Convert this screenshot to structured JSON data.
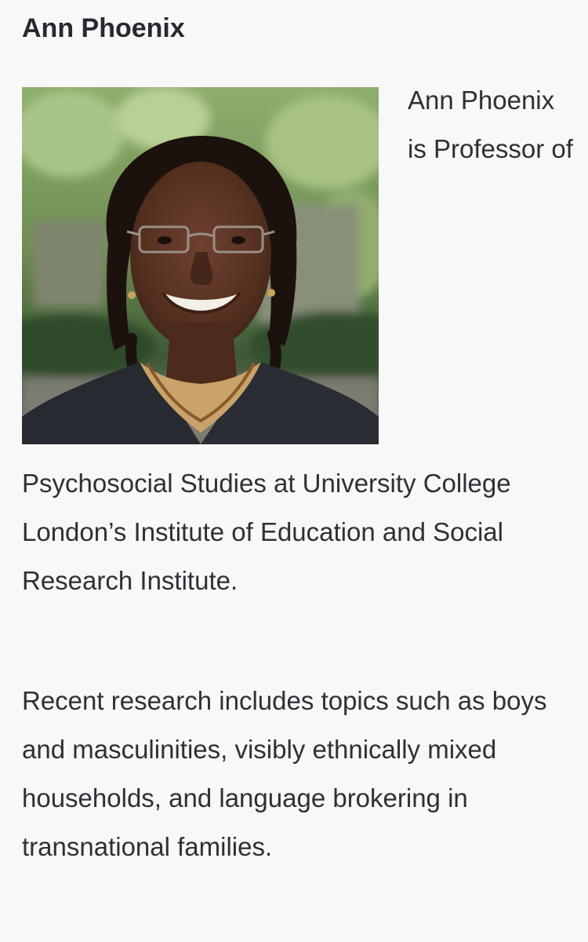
{
  "profile": {
    "name": "Ann Phoenix",
    "photo_alt": "Ann Phoenix",
    "intro_part1": "Ann Phoenix is Professor of",
    "intro_part2": "Psychosocial Studies at University College London’s Institute of Education and Social Research Institute.",
    "research": "Recent research includes topics such as boys and masculinities, visibly ethnically mixed households, and language brokering in transnational families."
  }
}
